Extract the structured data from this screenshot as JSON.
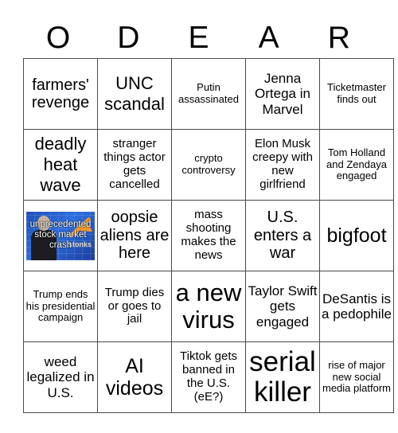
{
  "header": {
    "letters": [
      "O",
      "D",
      "E",
      "A",
      "R"
    ]
  },
  "board": {
    "rows": [
      [
        {
          "text": "farmers' revenge"
        },
        {
          "text": "UNC scandal"
        },
        {
          "text": "Putin assassinated"
        },
        {
          "text": "Jenna Ortega in Marvel"
        },
        {
          "text": "Ticketmaster finds out"
        }
      ],
      [
        {
          "text": "deadly heat wave"
        },
        {
          "text": "stranger things actor gets cancelled"
        },
        {
          "text": "crypto controversy"
        },
        {
          "text": "Elon Musk creepy with new girlfriend"
        },
        {
          "text": "Tom Holland and Zendaya engaged"
        }
      ],
      [
        {
          "text": "unprecedented stock market crash",
          "image": "stonks-meme",
          "image_overlay": "stonks"
        },
        {
          "text": "oopsie aliens are here"
        },
        {
          "text": "mass shooting makes the news"
        },
        {
          "text": "U.S. enters a war"
        },
        {
          "text": "bigfoot"
        }
      ],
      [
        {
          "text": "Trump ends his presidential campaign"
        },
        {
          "text": "Trump dies or goes to jail"
        },
        {
          "text": "a new virus"
        },
        {
          "text": "Taylor Swift gets engaged"
        },
        {
          "text": "DeSantis is a pedophile"
        }
      ],
      [
        {
          "text": "weed legalized in U.S."
        },
        {
          "text": "AI videos"
        },
        {
          "text": "Tiktok gets banned in the U.S. (eE?)"
        },
        {
          "text": "serial killer"
        },
        {
          "text": "rise of major new social media platform"
        }
      ]
    ]
  },
  "colors": {
    "grid_line": "#4a4a4a",
    "background": "#ffffff",
    "text": "#000000"
  }
}
